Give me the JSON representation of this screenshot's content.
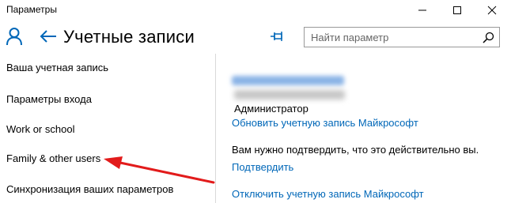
{
  "window": {
    "title": "Параметры"
  },
  "header": {
    "title": "Учетные записи",
    "search_placeholder": "Найти параметр"
  },
  "sidebar": {
    "items": [
      {
        "label": "Ваша учетная запись"
      },
      {
        "label": "Параметры входа"
      },
      {
        "label": "Work or school"
      },
      {
        "label": "Family & other users"
      },
      {
        "label": "Синхронизация ваших параметров"
      }
    ]
  },
  "main": {
    "role": "Администратор",
    "link_update": "Обновить учетную запись Майкрософт",
    "verify_prompt": "Вам нужно подтвердить, что это действительно вы.",
    "link_verify": "Подтвердить",
    "link_disable": "Отключить учетную запись Майкрософт"
  },
  "colors": {
    "accent_link": "#0067b8",
    "annotation_arrow": "#e21b1b"
  },
  "icons": {
    "user": "user-icon",
    "back": "back-arrow-icon",
    "pin": "pin-icon",
    "search": "search-icon",
    "minimize": "minimize-icon",
    "maximize": "maximize-icon",
    "close": "close-icon"
  }
}
